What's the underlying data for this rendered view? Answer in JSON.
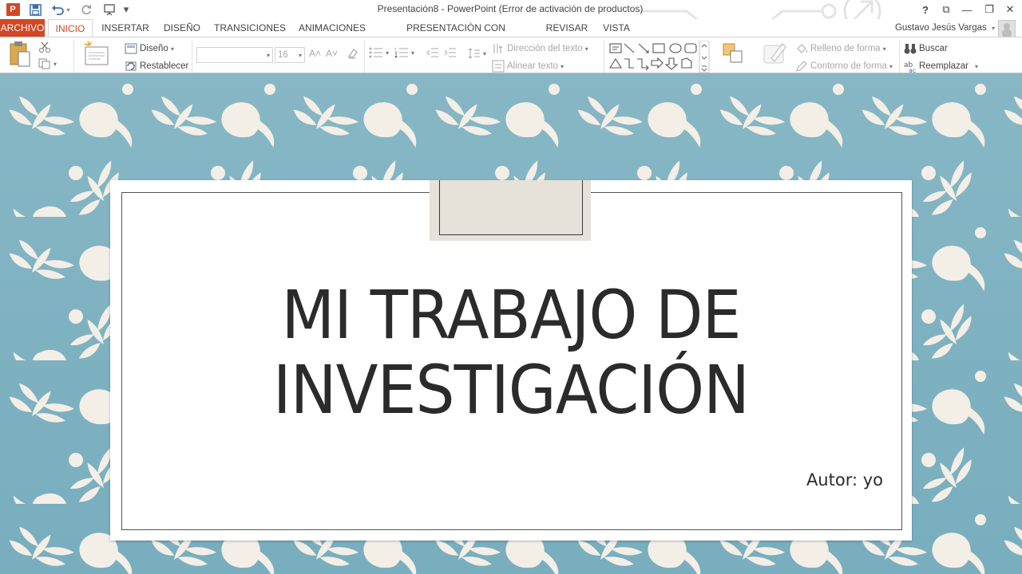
{
  "app": {
    "logo_text": "P",
    "title": "Presentación8 - PowerPoint (Error de activación de productos)",
    "brand_color": "#d24726"
  },
  "window_controls": {
    "help": "?",
    "ribbon_options": "⧉",
    "minimize": "—",
    "maximize": "❐",
    "close": "✕"
  },
  "quick_access": {
    "save_icon": "floppy-disk-icon",
    "undo_icon": "undo-icon",
    "redo_icon": "redo-icon",
    "present_icon": "start-presentation-icon",
    "customize_glyph": "▾"
  },
  "tabs": [
    {
      "label": "ARCHIVO"
    },
    {
      "label": "INICIO"
    },
    {
      "label": "INSERTAR"
    },
    {
      "label": "DISEÑO"
    },
    {
      "label": "TRANSICIONES"
    },
    {
      "label": "ANIMACIONES"
    },
    {
      "label": "PRESENTACIÓN CON DIAPOSITIVAS"
    },
    {
      "label": "REVISAR"
    },
    {
      "label": "VISTA"
    }
  ],
  "user": {
    "name": "Gustavo Jesús Vargas",
    "caret": "▾"
  },
  "ribbon": {
    "layout_label": "Diseño",
    "reset_label": "Restablecer",
    "font_name_value": "",
    "font_size_value": "16",
    "grow_font": "A˄",
    "shrink_font": "A˅",
    "text_direction_label": "Dirección del texto",
    "align_text_label": "Alinear texto",
    "shape_fill_label": "Relleno de forma",
    "shape_outline_label": "Contorno de forma",
    "find_label": "Buscar",
    "replace_label": "Reemplazar"
  },
  "slide": {
    "title_line1": "MI TRABAJO DE",
    "title_line2": "INVESTIGACIÓN",
    "subtitle": "Autor: yo",
    "background_color": "#83b4c3",
    "pattern_color": "#f3eee6"
  }
}
